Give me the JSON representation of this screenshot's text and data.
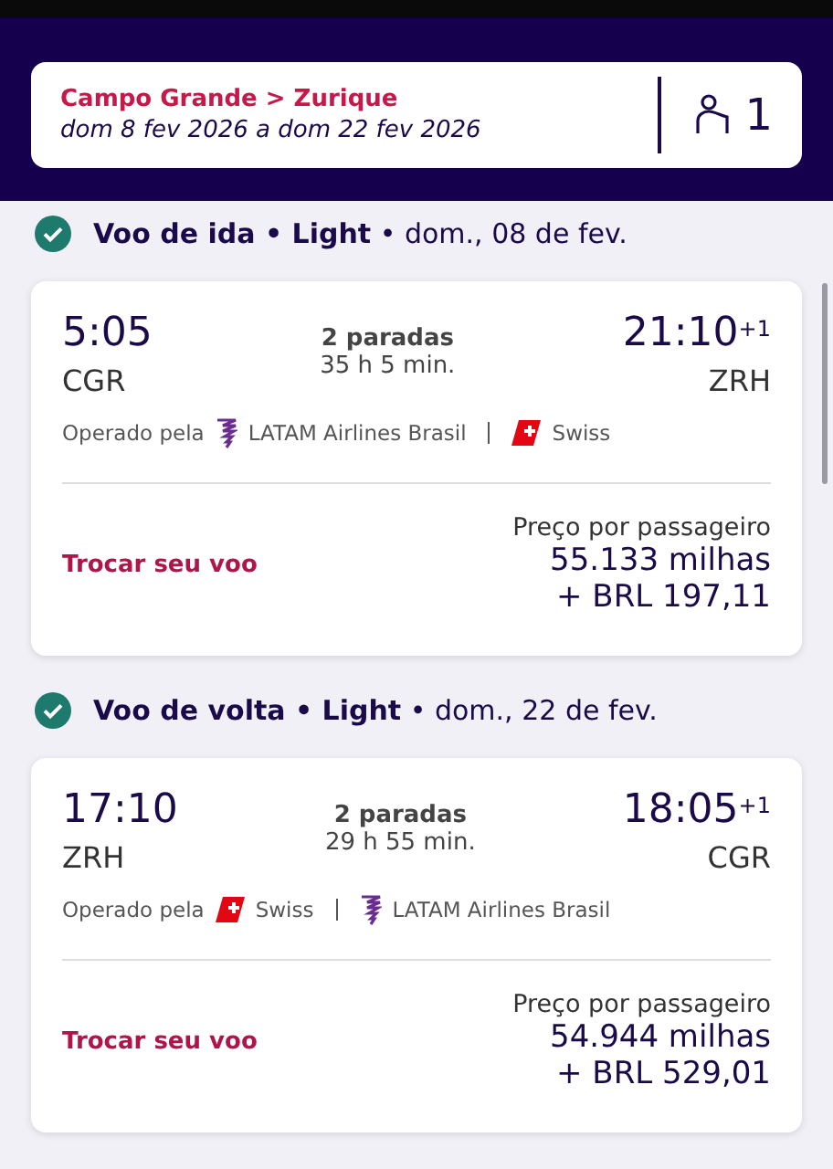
{
  "search_summary": {
    "route": "Campo Grande > Zurique",
    "dates": "dom 8 fev 2026 a dom 22 fev 2026",
    "passengers": "1"
  },
  "flights": [
    {
      "heading": "**Voo de ida • Light** • dom., 08 de fev.",
      "depart_time": "5:05",
      "depart_airport": "CGR",
      "stops": "2 paradas",
      "duration": "35 h 5 min.",
      "arrive_time": "21:10",
      "day_offset": "+1",
      "arrive_airport": "ZRH",
      "operated_label": "Operado pela",
      "airlines": [
        {
          "kind": "latam",
          "name": "LATAM Airlines Brasil"
        },
        {
          "kind": "swiss",
          "name": "Swiss"
        }
      ],
      "change_link": "Trocar seu voo",
      "price_label": "Preço por passageiro",
      "miles": "55.133 milhas",
      "cash": "+ BRL 197,11"
    },
    {
      "heading": "**Voo de volta • Light** • dom., 22 de fev.",
      "depart_time": "17:10",
      "depart_airport": "ZRH",
      "stops": "2 paradas",
      "duration": "29 h 55 min.",
      "arrive_time": "18:05",
      "day_offset": "+1",
      "arrive_airport": "CGR",
      "operated_label": "Operado pela",
      "airlines": [
        {
          "kind": "swiss",
          "name": "Swiss"
        },
        {
          "kind": "latam",
          "name": "LATAM Airlines Brasil"
        }
      ],
      "change_link": "Trocar seu voo",
      "price_label": "Preço por passageiro",
      "miles": "54.944 milhas",
      "cash": "+ BRL 529,01"
    }
  ]
}
